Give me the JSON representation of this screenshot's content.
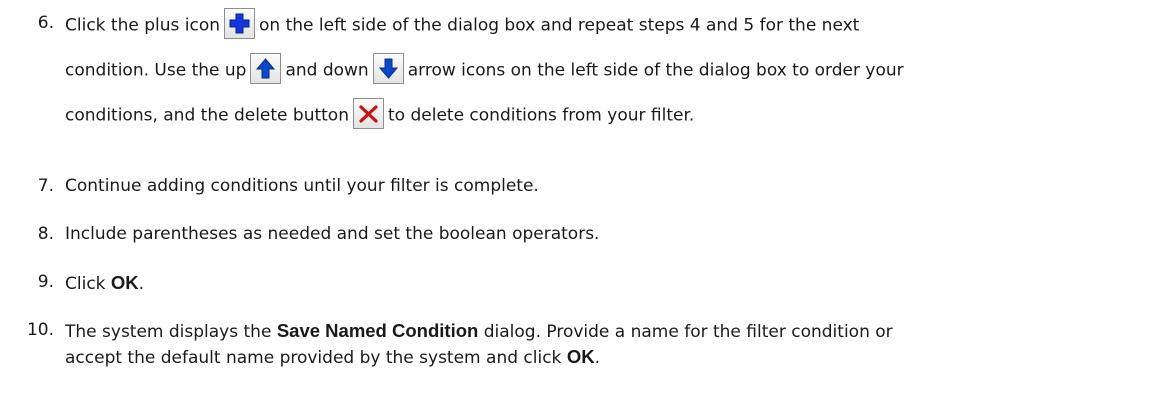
{
  "steps": [
    {
      "number": "6.",
      "line1": {
        "a": "Click the plus icon",
        "b": "on the left side of the dialog box and repeat steps 4 and 5 for the next"
      },
      "line2": {
        "a": "condition. Use the up",
        "b": "and down",
        "c": "arrow icons on the left side of the dialog box to order your"
      },
      "line3": {
        "a": "conditions, and the delete button",
        "b": "to delete conditions from your filter."
      },
      "icons": [
        "plus-icon",
        "up-arrow-icon",
        "down-arrow-icon",
        "delete-x-icon"
      ]
    },
    {
      "number": "7.",
      "text": "Continue adding conditions until your filter is complete."
    },
    {
      "number": "8.",
      "text": "Include parentheses as needed and set the boolean operators."
    },
    {
      "number": "9.",
      "text_before": "Click",
      "ui": "OK",
      "text_after": "."
    },
    {
      "number": "10.",
      "line1": {
        "a": "The system displays the",
        "ui": "Save Named Condition",
        "b": "dialog. Provide a name for the filter condition or"
      },
      "line2": {
        "a": "accept the default name provided by the system and click",
        "ui": "OK",
        "b": "."
      }
    }
  ],
  "colors": {
    "text": "#1a1a1a",
    "plus_icon": "#1436e0",
    "arrow_icon": "#0a47c9",
    "delete_icon": "#cc1010"
  }
}
